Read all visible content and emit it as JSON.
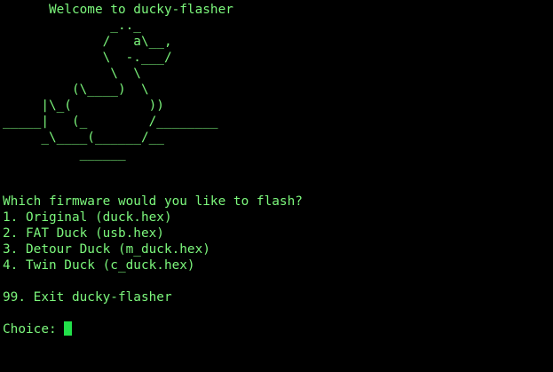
{
  "terminal": {
    "text_color": "#7cf77c",
    "cursor_color": "#22e04a",
    "background": "#000000",
    "welcome": "      Welcome to ducky-flasher",
    "art": [
      "              _.._",
      "             /   a\\__,",
      "             \\  -.___/",
      "              \\  \\",
      "         (\\____)  \\",
      "     |\\_(          ))",
      "_____|   (_        /________",
      "     _\\____(______/__",
      "          ______"
    ],
    "prompt_question": "Which firmware would you like to flash?",
    "options": [
      "1. Original (duck.hex)",
      "2. FAT Duck (usb.hex)",
      "3. Detour Duck (m_duck.hex)",
      "4. Twin Duck (c_duck.hex)"
    ],
    "exit_option": "99. Exit ducky-flasher",
    "choice_prompt": "Choice: "
  }
}
